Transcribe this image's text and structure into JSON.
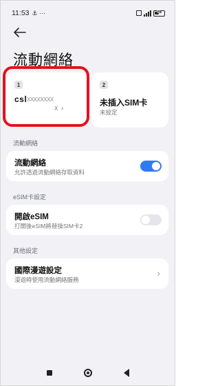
{
  "status_bar": {
    "time": "11:53",
    "extra_icons": "⚓ ···",
    "battery_level": "35"
  },
  "header": {
    "title": "流動網絡"
  },
  "sim_cards": [
    {
      "slot": "1",
      "name": "csl",
      "masked_number": "XXXXXXXX",
      "sub": "X"
    },
    {
      "slot": "2",
      "name": "未插入SIM卡",
      "sub": "未設定"
    }
  ],
  "sections": {
    "mobile_network": {
      "label": "流動網絡",
      "title": "流動網絡",
      "desc": "允許透過流動網絡存取資料",
      "toggle_on": true
    },
    "esim": {
      "label": "eSIM卡設定",
      "title": "開啟eSIM",
      "desc": "打開後eSIM將替換SIM卡2",
      "toggle_on": false
    },
    "other": {
      "label": "其他設定",
      "title": "國際漫遊設定",
      "desc": "漫遊時使用流動網絡服務"
    }
  },
  "colors": {
    "accent": "#2f7cf0",
    "highlight": "#e0141e",
    "background": "#f2f2f6"
  },
  "icons": {
    "back": "arrow-left-icon",
    "chevron": "chevron-right-icon"
  }
}
